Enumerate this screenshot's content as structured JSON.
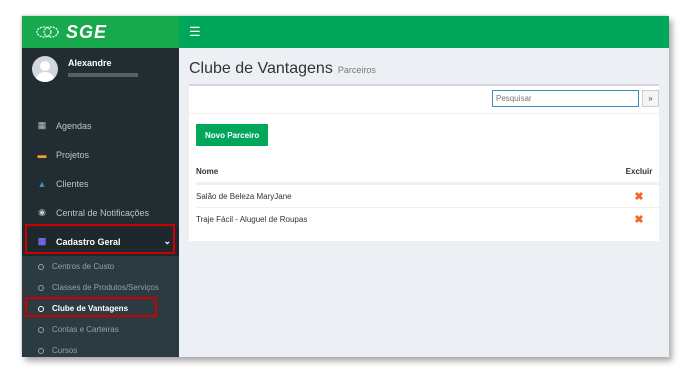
{
  "brand": {
    "logo_text": "SGE"
  },
  "topbar": {
    "menu_icon": "hamburger-icon"
  },
  "user": {
    "name": "Alexandre"
  },
  "sidebar": {
    "items": [
      {
        "label": "Agendas",
        "icon": "calendar-icon",
        "glyph": "▦"
      },
      {
        "label": "Projetos",
        "icon": "folder-icon",
        "glyph": "▬"
      },
      {
        "label": "Clientes",
        "icon": "user-icon",
        "glyph": "▲"
      },
      {
        "label": "Central de Notificações",
        "icon": "rss-icon",
        "glyph": "◉"
      },
      {
        "label": "Cadastro Geral",
        "icon": "grid-icon",
        "glyph": "▦"
      }
    ],
    "sub_items": [
      {
        "label": "Centros de Custo"
      },
      {
        "label": "Classes de Produtos/Serviços"
      },
      {
        "label": "Clube de Vantagens"
      },
      {
        "label": "Contas e Carteiras"
      },
      {
        "label": "Cursos"
      }
    ]
  },
  "page": {
    "title": "Clube de Vantagens",
    "subtitle": "Parceiros"
  },
  "search": {
    "placeholder": "Pesquisar",
    "button": "»"
  },
  "actions": {
    "new_label": "Novo Parceiro"
  },
  "table": {
    "headers": {
      "name": "Nome",
      "delete": "Excluir"
    },
    "rows": [
      {
        "name": "Salão de Beleza MaryJane",
        "delete_icon": "✖"
      },
      {
        "name": "Traje Fácil - Aluguel de Roupas",
        "delete_icon": "✖"
      }
    ]
  },
  "colors": {
    "accent": "#00a65a",
    "sidebar": "#222d32",
    "highlight": "#cc0000",
    "delete": "#f26522"
  }
}
